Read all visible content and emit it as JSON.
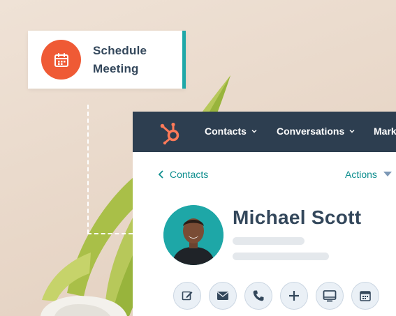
{
  "schedule_card": {
    "label_line1": "Schedule",
    "label_line2": "Meeting",
    "icon": "calendar-icon",
    "accent_color": "#ef5a35",
    "border_color": "#1fa8a8"
  },
  "navbar": {
    "background": "#2d3e50",
    "logo": "hubspot-sprocket-icon",
    "items": [
      {
        "label": "Contacts"
      },
      {
        "label": "Conversations"
      },
      {
        "label": "Mark"
      }
    ]
  },
  "subbar": {
    "back_label": "Contacts",
    "actions_label": "Actions"
  },
  "contact": {
    "name": "Michael Scott",
    "avatar_bg": "#1ea7a7"
  },
  "action_buttons": [
    {
      "name": "note",
      "icon": "edit-note-icon"
    },
    {
      "name": "email",
      "icon": "mail-icon"
    },
    {
      "name": "call",
      "icon": "phone-icon"
    },
    {
      "name": "add",
      "icon": "plus-icon"
    },
    {
      "name": "screen",
      "icon": "monitor-icon"
    },
    {
      "name": "schedule",
      "icon": "calendar-icon"
    }
  ],
  "colors": {
    "teal_link": "#0f8f8f",
    "heading_text": "#33475b"
  }
}
